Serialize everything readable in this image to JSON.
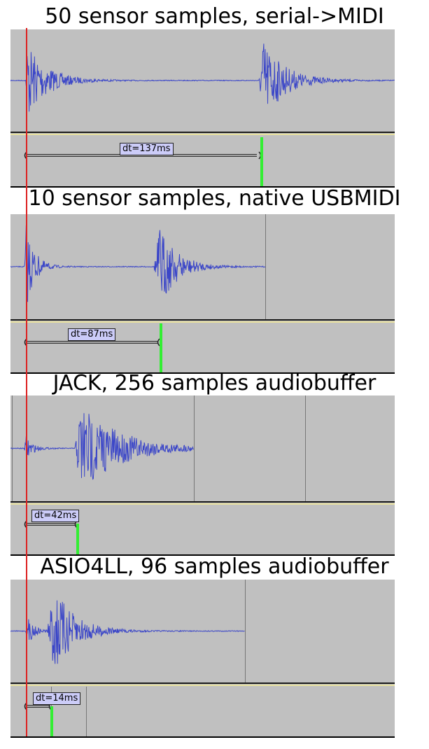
{
  "panels": [
    {
      "title": "50 sensor samples, serial->MIDI",
      "dt_label": "dt=137ms"
    },
    {
      "title": "10 sensor samples, native USBMIDI",
      "dt_label": "dt=87ms"
    },
    {
      "title": "JACK, 256 samples audiobuffer",
      "dt_label": "dt=42ms"
    },
    {
      "title": "ASIO4LL, 96 samples audiobuffer",
      "dt_label": "dt=14ms"
    }
  ],
  "colors": {
    "waveform": "#3b46c8",
    "track_background": "#c0c0c0",
    "marker": "#33ee33",
    "cursor": "#dd2222",
    "label_fill": "#ccccf8"
  }
}
